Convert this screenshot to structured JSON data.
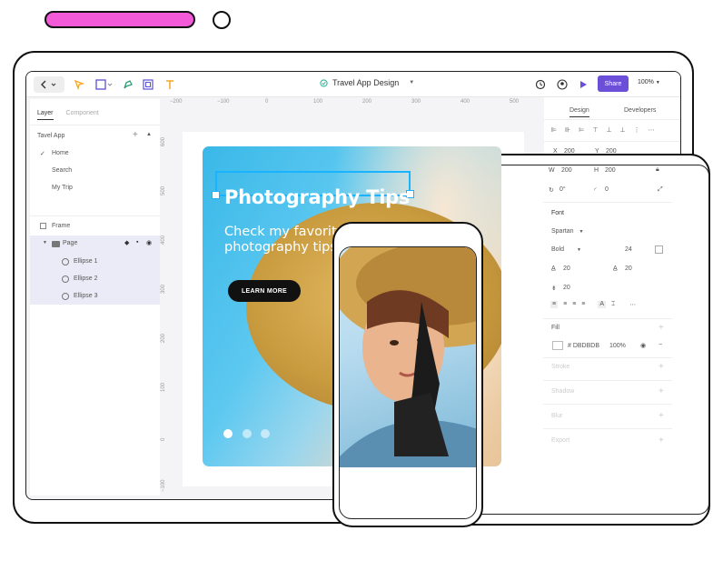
{
  "app": {
    "file_title": "Travel App Design",
    "share_label": "Share",
    "zoom": "100%"
  },
  "left_panel": {
    "tabs": [
      "Layer",
      "Component"
    ],
    "group_title": "Tavel App",
    "pages": [
      "Home",
      "Search",
      "My Trip"
    ],
    "layers": {
      "frame": "Frame",
      "page": "Page",
      "ellipses": [
        "Ellipse 1",
        "Ellipse 2",
        "Ellipse 3"
      ]
    }
  },
  "rulers": {
    "top": [
      "−200",
      "−100",
      "0",
      "100",
      "200",
      "300",
      "400",
      "500"
    ],
    "left": [
      "600",
      "500",
      "400",
      "300",
      "200",
      "100",
      "0",
      "−100"
    ]
  },
  "hero": {
    "title": "Photography Tips",
    "subtitle": "Check my favorite travel photography tips for beginners.",
    "button": "LEARN MORE",
    "dots": 3
  },
  "right_panel": {
    "tabs": [
      "Design",
      "Developers"
    ],
    "x_label": "X",
    "x_value": "200",
    "y_label": "Y",
    "y_value": "200",
    "w_label": "W",
    "w_value": "200",
    "h_label": "H",
    "h_value": "200",
    "rotation": "0°",
    "radius": "0",
    "font_section": "Font",
    "font_family": "Spartan",
    "font_weight": "Bold",
    "font_size": "24",
    "line_height": "20",
    "letter_spacing": "20",
    "paragraph": "20",
    "fill_section": "Fill",
    "fill_hex": "# DBDBDB",
    "fill_opacity": "100%",
    "sections": [
      "Stroke",
      "Shadow",
      "Blur",
      "Export"
    ]
  },
  "colors": {
    "accent": "#6b4fd8",
    "selection": "#1ab3ff",
    "brand_pink": "#f25ad8"
  }
}
